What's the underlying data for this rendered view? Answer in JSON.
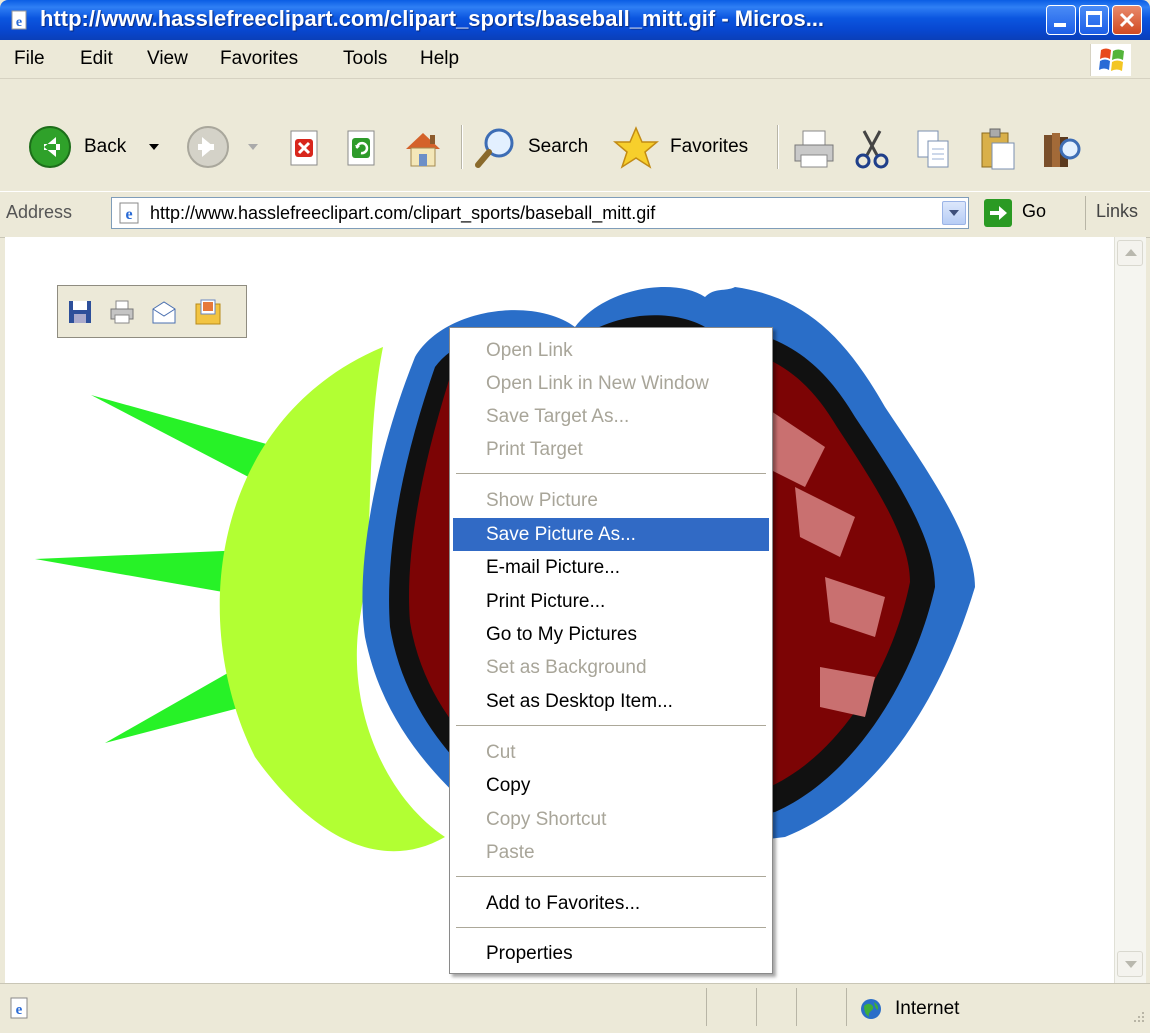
{
  "window": {
    "title": "http://www.hasslefreeclipart.com/clipart_sports/baseball_mitt.gif - Micros...",
    "colors": {
      "titlebar": "#0a56e0",
      "highlight": "#316ac5",
      "chrome": "#ece9d8"
    }
  },
  "menubar": {
    "items": [
      "File",
      "Edit",
      "View",
      "Favorites",
      "Tools",
      "Help"
    ]
  },
  "toolbar": {
    "back_label": "Back",
    "search_label": "Search",
    "favorites_label": "Favorites"
  },
  "address": {
    "label": "Address",
    "url": "http://www.hasslefreeclipart.com/clipart_sports/baseball_mitt.gif",
    "go_label": "Go",
    "links_label": "Links"
  },
  "context_menu": {
    "items": [
      {
        "label": "Open Link",
        "enabled": false
      },
      {
        "label": "Open Link in New Window",
        "enabled": false
      },
      {
        "label": "Save Target As...",
        "enabled": false
      },
      {
        "label": "Print Target",
        "enabled": false
      },
      {
        "label": "Show Picture",
        "enabled": false
      },
      {
        "label": "Save Picture As...",
        "enabled": true,
        "highlighted": true
      },
      {
        "label": "E-mail Picture...",
        "enabled": true
      },
      {
        "label": "Print Picture...",
        "enabled": true
      },
      {
        "label": "Go to My Pictures",
        "enabled": true
      },
      {
        "label": "Set as Background",
        "enabled": false
      },
      {
        "label": "Set as Desktop Item...",
        "enabled": true
      },
      {
        "label": "Cut",
        "enabled": false
      },
      {
        "label": "Copy",
        "enabled": true
      },
      {
        "label": "Copy Shortcut",
        "enabled": false
      },
      {
        "label": "Paste",
        "enabled": false
      },
      {
        "label": "Add to Favorites...",
        "enabled": true
      },
      {
        "label": "Properties",
        "enabled": true
      }
    ]
  },
  "statusbar": {
    "zone": "Internet"
  }
}
